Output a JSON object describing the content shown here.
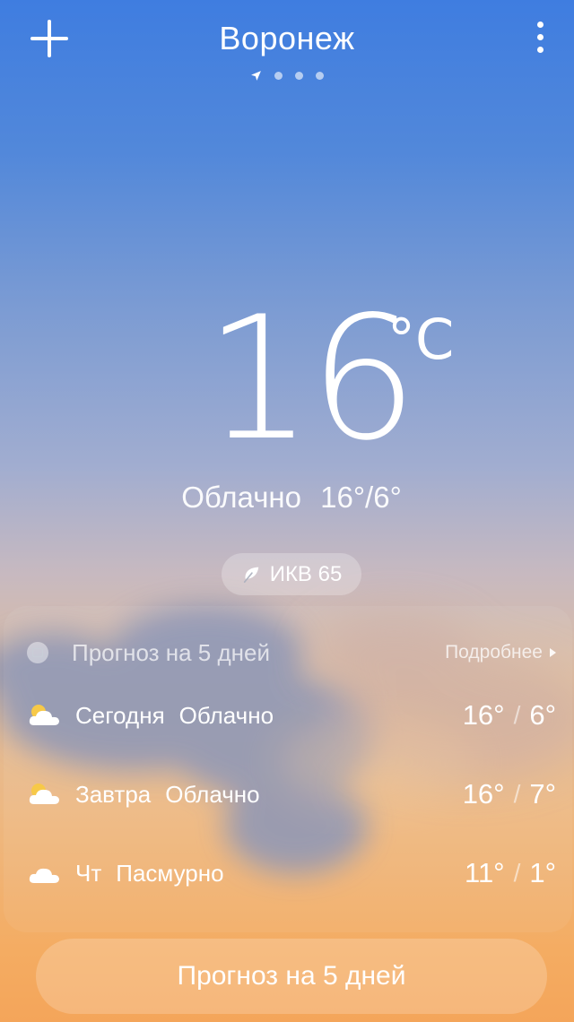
{
  "header": {
    "city": "Воронеж",
    "add_icon": "plus-icon",
    "menu_icon": "more-vertical-icon",
    "pager": {
      "pages": 4,
      "current": 0,
      "current_icon": "location-arrow-icon"
    }
  },
  "current": {
    "temperature": "16",
    "unit": "°C",
    "condition": "Облачно",
    "range": "16°/6°",
    "aqi": {
      "icon": "leaf-icon",
      "label": "ИКВ 65"
    }
  },
  "forecast": {
    "icon": "calendar-icon",
    "title": "Прогноз на 5 дней",
    "more_label": "Подробнее",
    "days": [
      {
        "day": "Сегодня",
        "condition": "Облачно",
        "high": "16°",
        "low": "6°",
        "icon": "partly-cloudy-icon"
      },
      {
        "day": "Завтра",
        "condition": "Облачно",
        "high": "16°",
        "low": "7°",
        "icon": "partly-cloudy-icon"
      },
      {
        "day": "Чт",
        "condition": "Пасмурно",
        "high": "11°",
        "low": "1°",
        "icon": "cloud-icon"
      }
    ],
    "slash": "/",
    "button_label": "Прогноз на 5 дней"
  },
  "colors": {
    "sky_top": "#3f7de0",
    "sky_bottom": "#f4a55a"
  }
}
